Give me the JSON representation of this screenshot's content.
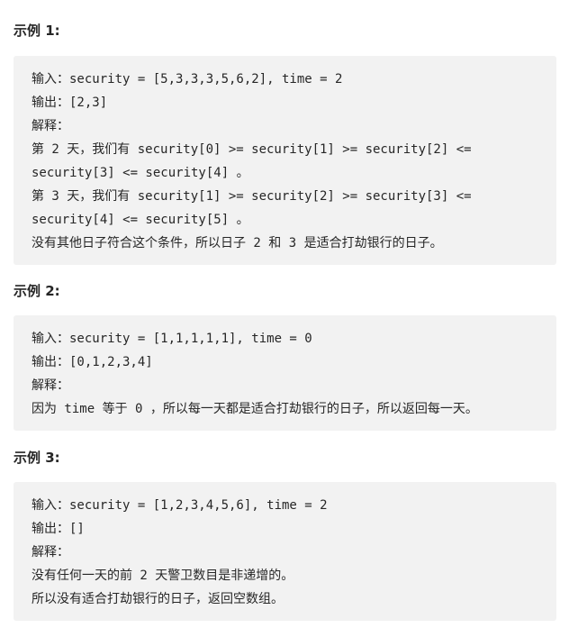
{
  "examples": [
    {
      "heading": "示例 1:",
      "lines": [
        "输入：security = [5,3,3,3,5,6,2], time = 2",
        "输出：[2,3]",
        "解释：",
        "第 2 天，我们有 security[0] >= security[1] >= security[2] <=",
        "security[3] <= security[4] 。",
        "第 3 天，我们有 security[1] >= security[2] >= security[3] <=",
        "security[4] <= security[5] 。",
        "没有其他日子符合这个条件，所以日子 2 和 3 是适合打劫银行的日子。"
      ]
    },
    {
      "heading": "示例 2:",
      "lines": [
        "输入：security = [1,1,1,1,1], time = 0",
        "输出：[0,1,2,3,4]",
        "解释：",
        "因为 time 等于 0 ，所以每一天都是适合打劫银行的日子，所以返回每一天。"
      ]
    },
    {
      "heading": "示例 3:",
      "lines": [
        "输入：security = [1,2,3,4,5,6], time = 2",
        "输出：[]",
        "解释：",
        "没有任何一天的前 2 天警卫数目是非递增的。",
        "所以没有适合打劫银行的日子，返回空数组。"
      ]
    }
  ]
}
